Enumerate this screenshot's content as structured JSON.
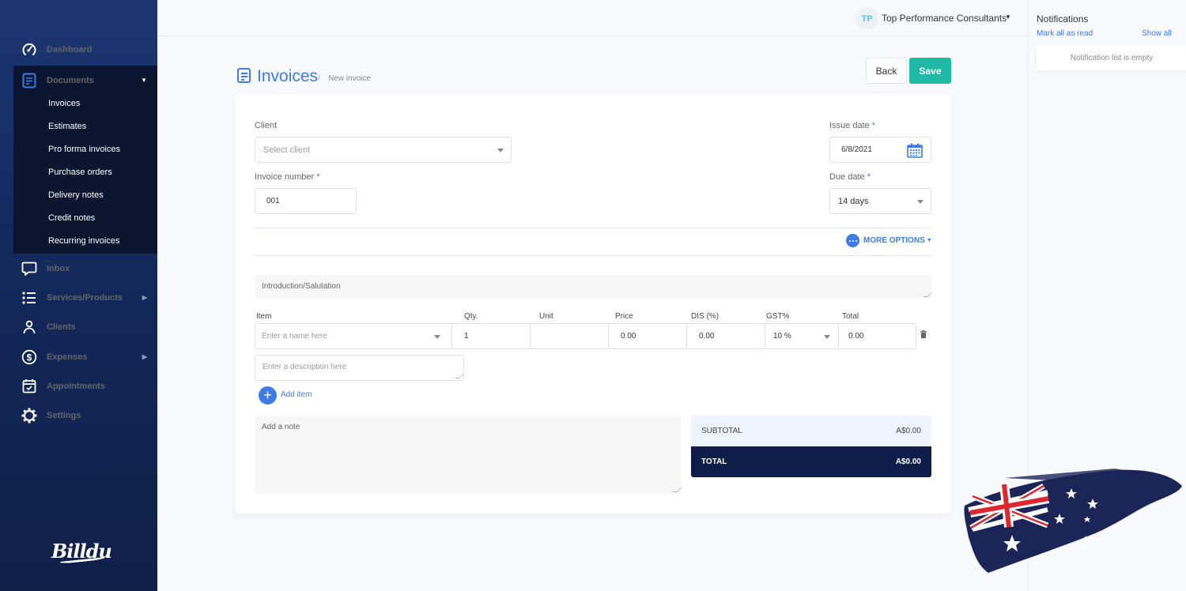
{
  "sidebar": {
    "items": [
      {
        "label": "Dashboard",
        "icon": "dashboard-gauge-icon"
      },
      {
        "label": "Documents",
        "icon": "document-icon",
        "expanded": true
      },
      {
        "label": "Inbox",
        "icon": "chat-bubble-icon"
      },
      {
        "label": "Services/Products",
        "icon": "list-icon",
        "has_submenu": true
      },
      {
        "label": "Clients",
        "icon": "user-icon"
      },
      {
        "label": "Expenses",
        "icon": "dollar-circle-icon",
        "has_submenu": true
      },
      {
        "label": "Appointments",
        "icon": "calendar-check-icon"
      },
      {
        "label": "Settings",
        "icon": "gear-icon"
      }
    ],
    "documents_submenu": [
      "Invoices",
      "Estimates",
      "Pro forma invoices",
      "Purchase orders",
      "Delivery notes",
      "Credit notes",
      "Recurring invoices"
    ],
    "logo": "Billdu"
  },
  "topbar": {
    "avatar_initials": "TP",
    "company_name": "Top Performance Consultants"
  },
  "notifications": {
    "title": "Notifications",
    "mark_all_read": "Mark all as read",
    "show_all": "Show all",
    "empty_message": "Notification list is empty"
  },
  "header": {
    "title": "Invoices",
    "breadcrumb_sep": "/",
    "breadcrumb": "New invoice",
    "back_label": "Back",
    "save_label": "Save"
  },
  "form": {
    "client_label": "Client",
    "client_placeholder": "Select client",
    "invoice_number_label": "Invoice number",
    "invoice_number_value": "001",
    "issue_date_label": "Issue date",
    "issue_date_value": "6/8/2021",
    "due_date_label": "Due date",
    "due_date_value": "14 days",
    "required_mark": "*",
    "more_options": "MORE OPTIONS",
    "intro_placeholder": "Introduction/Salutation",
    "columns": [
      "Item",
      "Qty.",
      "Unit",
      "Price",
      "DIS (%)",
      "GST%",
      "Total"
    ],
    "line_item": {
      "name_placeholder": "Enter a name here",
      "qty": "1",
      "unit": "",
      "price": "0.00",
      "discount": "0.00",
      "gst": "10 %",
      "total": "0.00",
      "description_placeholder": "Enter a description here"
    },
    "add_item_label": "Add item",
    "note_placeholder": "Add a note",
    "subtotal_label": "SUBTOTAL",
    "subtotal_value": "A$0.00",
    "total_label": "TOTAL",
    "total_value": "A$0.00"
  },
  "colors": {
    "accent_blue": "#3d7be8",
    "save_teal": "#20b8a7",
    "sidebar_navy": "#142a5e",
    "total_navy": "#0d1e4a"
  }
}
